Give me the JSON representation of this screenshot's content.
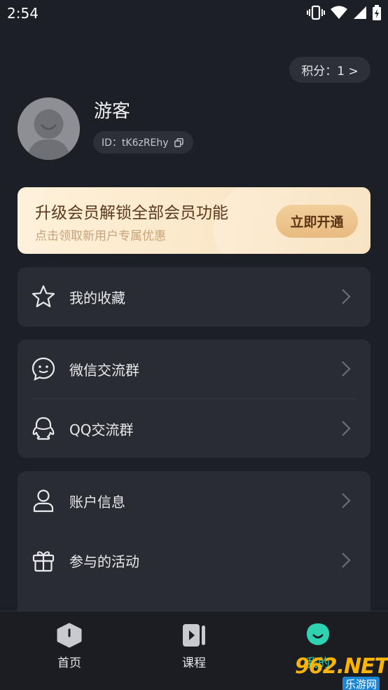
{
  "status_bar": {
    "time": "2:54"
  },
  "points": {
    "label": "积分：1 >"
  },
  "profile": {
    "username": "游客",
    "id_text": "ID：tK6zREhy"
  },
  "vip_banner": {
    "title": "升级会员解锁全部会员功能",
    "subtitle": "点击领取新用户专属优惠",
    "button_label": "立即开通"
  },
  "menu": {
    "favorites": "我的收藏",
    "wechat_group": "微信交流群",
    "qq_group": "QQ交流群",
    "account_info": "账户信息",
    "activities": "参与的活动"
  },
  "tabs": [
    {
      "label": "首页",
      "icon": "home-icon"
    },
    {
      "label": "课程",
      "icon": "course-icon"
    },
    {
      "label": "我的",
      "icon": "mine-icon"
    }
  ],
  "watermark": {
    "brand": "962.NET",
    "sub": "乐游网"
  },
  "colors": {
    "background": "#1d1f26",
    "card": "#2a2c34",
    "accent": "#2fd3b1",
    "vip_button": "#ecc48d"
  }
}
